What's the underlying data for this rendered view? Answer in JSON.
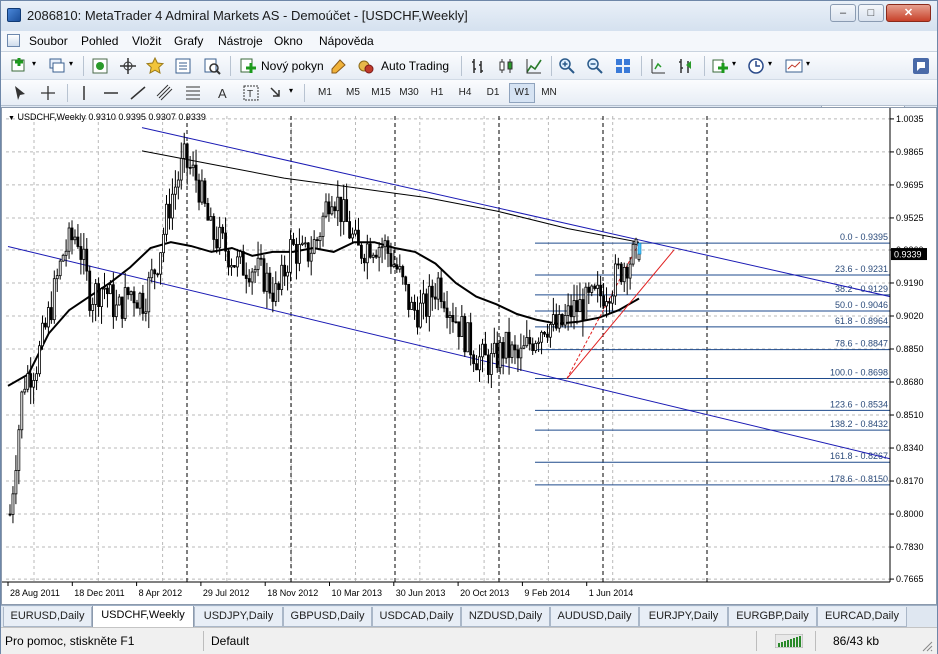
{
  "window": {
    "title": "2086810: MetaTrader 4 Admiral Markets AS - Demoúčet - [USDCHF,Weekly]",
    "buttons": {
      "minimize": "–",
      "maximize": "□",
      "close": "✕"
    }
  },
  "menu": [
    "Soubor",
    "Pohled",
    "Vložit",
    "Grafy",
    "Nástroje",
    "Okno",
    "Nápověda"
  ],
  "toolbar": {
    "new_order": "Nový pokyn",
    "auto_trading": "Auto Trading",
    "search_placeholder": ""
  },
  "timeframes": [
    "M1",
    "M5",
    "M15",
    "M30",
    "H1",
    "H4",
    "D1",
    "W1",
    "MN"
  ],
  "active_timeframe": "W1",
  "chart_data": {
    "type": "candlestick",
    "symbol": "USDCHF,Weekly",
    "ohlc_text": "0.9310 0.9395 0.9307 0.9339",
    "ylim": [
      0.765,
      1.005
    ],
    "y_ticks": [
      "1.0035",
      "0.9865",
      "0.9695",
      "0.9525",
      "0.9360",
      "0.9190",
      "0.9020",
      "0.8850",
      "0.8680",
      "0.8510",
      "0.8340",
      "0.8170",
      "0.8000",
      "0.7830",
      "0.7665"
    ],
    "current_price": "0.9339",
    "x_labels": [
      "28 Aug 2011",
      "18 Dec 2011",
      "8 Apr 2012",
      "29 Jul 2012",
      "18 Nov 2012",
      "10 Mar 2013",
      "30 Jun 2013",
      "20 Oct 2013",
      "9 Feb 2014",
      "1 Jun 2014"
    ],
    "close_path": [
      0.8,
      0.868,
      0.878,
      0.905,
      0.935,
      0.945,
      0.912,
      0.918,
      0.904,
      0.915,
      0.91,
      0.93,
      0.962,
      0.982,
      0.972,
      0.945,
      0.938,
      0.928,
      0.928,
      0.922,
      0.912,
      0.938,
      0.932,
      0.942,
      0.968,
      0.952,
      0.935,
      0.94,
      0.938,
      0.925,
      0.905,
      0.905,
      0.92,
      0.905,
      0.892,
      0.88,
      0.878,
      0.886,
      0.879,
      0.89,
      0.899,
      0.895,
      0.905,
      0.908,
      0.912,
      0.919,
      0.93,
      0.9339
    ],
    "ma_path": [
      0.866,
      0.872,
      0.893,
      0.905,
      0.912,
      0.919,
      0.927,
      0.937,
      0.94,
      0.938,
      0.935,
      0.937,
      0.933,
      0.935,
      0.935,
      0.937,
      0.935,
      0.94,
      0.94,
      0.937,
      0.935,
      0.929,
      0.919,
      0.912,
      0.908,
      0.903,
      0.9,
      0.898,
      0.899,
      0.901,
      0.905,
      0.911
    ],
    "fibonacci": [
      {
        "label": "0.0 - 0.9395",
        "value": 0.9395
      },
      {
        "label": "23.6 - 0.9231",
        "value": 0.9231
      },
      {
        "label": "38.2 - 0.9129",
        "value": 0.9129
      },
      {
        "label": "50.0 - 0.9046",
        "value": 0.9046
      },
      {
        "label": "61.8 - 0.8964",
        "value": 0.8964
      },
      {
        "label": "78.6 - 0.8847",
        "value": 0.8847
      },
      {
        "label": "100.0 - 0.8698",
        "value": 0.8698
      },
      {
        "label": "123.6 - 0.8534",
        "value": 0.8534
      },
      {
        "label": "138.2 - 0.8432",
        "value": 0.8432
      },
      {
        "label": "161.8 - 0.8267",
        "value": 0.8267
      },
      {
        "label": "178.6 - 0.8150",
        "value": 0.815
      }
    ],
    "colors": {
      "channel": "#1a1ab4",
      "fib": "#1e4a8c",
      "trend": "#e02020",
      "ma": "#000000",
      "candle": "#000000",
      "price_box": "#000000"
    }
  },
  "tabs": [
    "EURUSD,Daily",
    "USDCHF,Weekly",
    "USDJPY,Daily",
    "GBPUSD,Daily",
    "USDCAD,Daily",
    "NZDUSD,Daily",
    "AUDUSD,Daily",
    "EURJPY,Daily",
    "EURGBP,Daily",
    "EURCAD,Daily"
  ],
  "active_tab": "USDCHF,Weekly",
  "status": {
    "help": "Pro pomoc, stiskněte F1",
    "profile": "Default",
    "traffic": "86/43 kb"
  }
}
